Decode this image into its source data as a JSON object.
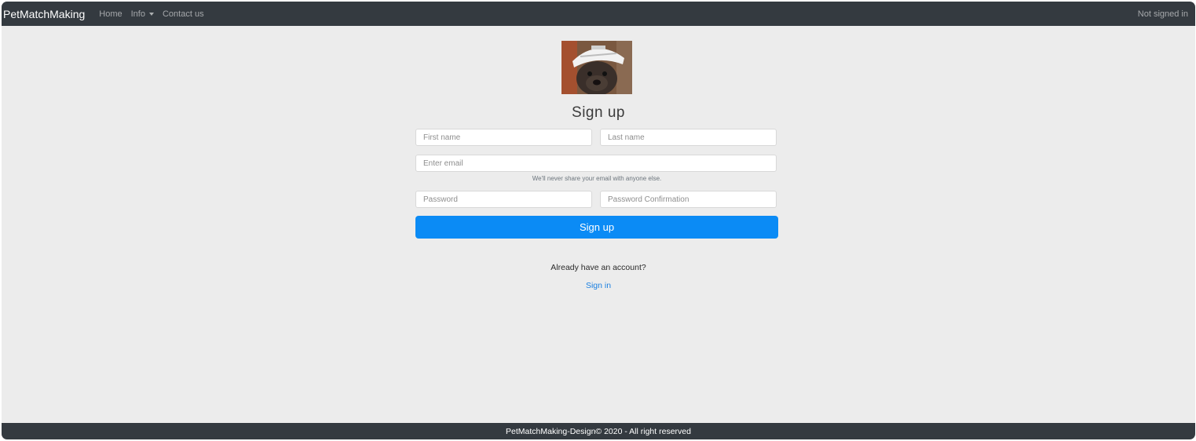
{
  "navbar": {
    "brand": "PetMatchMaking",
    "links": [
      {
        "label": "Home"
      },
      {
        "label": "Info"
      },
      {
        "label": "Contact us"
      }
    ],
    "status": "Not signed in"
  },
  "form": {
    "title": "Sign up",
    "first_name_placeholder": "First name",
    "last_name_placeholder": "Last name",
    "email_placeholder": "Enter email",
    "email_hint": "We'll never share your email with anyone else.",
    "password_placeholder": "Password",
    "password_confirmation_placeholder": "Password Confirmation",
    "submit_label": "Sign up"
  },
  "signin_prompt": {
    "text": "Already have an account?",
    "link_label": "Sign in"
  },
  "footer": {
    "text": "PetMatchMaking-Design© 2020 - All right reserved"
  },
  "colors": {
    "navbar_bg": "#343a40",
    "page_bg": "#ececec",
    "primary_button": "#0b8bf5",
    "link": "#1a7fe0"
  },
  "icons": {
    "info_dropdown": "caret-down-icon"
  }
}
